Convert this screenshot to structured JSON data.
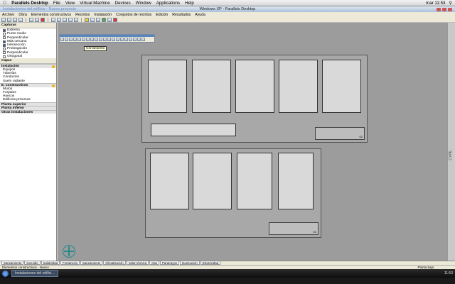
{
  "mac_menubar": {
    "app": "Parallels Desktop",
    "items": [
      "File",
      "View",
      "Virtual Machine",
      "Devices",
      "Window",
      "Applications",
      "Help"
    ],
    "clock": "mar 11:53"
  },
  "window": {
    "title": "Windows XP - Parallels Desktop",
    "left_title": "Instalaciones del edificio - Nuevo proyecto"
  },
  "app_menu": [
    "Archivo",
    "Obra",
    "Elementos constructivos",
    "Recintos",
    "Instalación",
    "Conjuntos de recintos",
    "Edición",
    "Resultados",
    "Ayuda"
  ],
  "left_panel": {
    "capturas_header": "Capturas",
    "capturas": [
      {
        "label": "Extremo",
        "on": true
      },
      {
        "label": "Punto medio",
        "on": false
      },
      {
        "label": "Perpendicular",
        "on": false
      },
      {
        "label": "Más cercano",
        "on": true
      },
      {
        "label": "Intersección",
        "on": true
      },
      {
        "label": "Prolongación",
        "on": false
      },
      {
        "label": "Perpendicular",
        "on": false
      },
      {
        "label": "Ortogonal",
        "on": false
      }
    ],
    "capas_header": "Capas",
    "sections": [
      {
        "title": "Instalación",
        "items": [
          "Equipos",
          "Tuberías",
          "Conductos",
          "Suelo radiante"
        ]
      },
      {
        "title": "E. constructivos",
        "items": [
          "Muros",
          "Forjados",
          "Huecos",
          "Edificios próximos"
        ]
      },
      {
        "title": "Planta superior",
        "items": []
      },
      {
        "title": "Planta inferior",
        "items": []
      },
      {
        "title": "Otras instalaciones",
        "items": []
      }
    ]
  },
  "tooltip": "Cerramiento",
  "scroll_label": "CYPE",
  "sheets": [
    {
      "label": "02"
    },
    {
      "label": "01"
    }
  ],
  "bottom_tabs": [
    "Saneamiento",
    "Incendio",
    "Salubridad",
    "Fontanería",
    "Saneamiento",
    "Climatización",
    "Solar térmica",
    "Gas",
    "Pararrayos",
    "Iluminación",
    "Electricidad"
  ],
  "status": {
    "left": "Elementos constructivos - Nuevo",
    "right": "Planta baja"
  },
  "taskbar": {
    "task": "Instalaciones del edifici...",
    "tray": "11:53"
  }
}
